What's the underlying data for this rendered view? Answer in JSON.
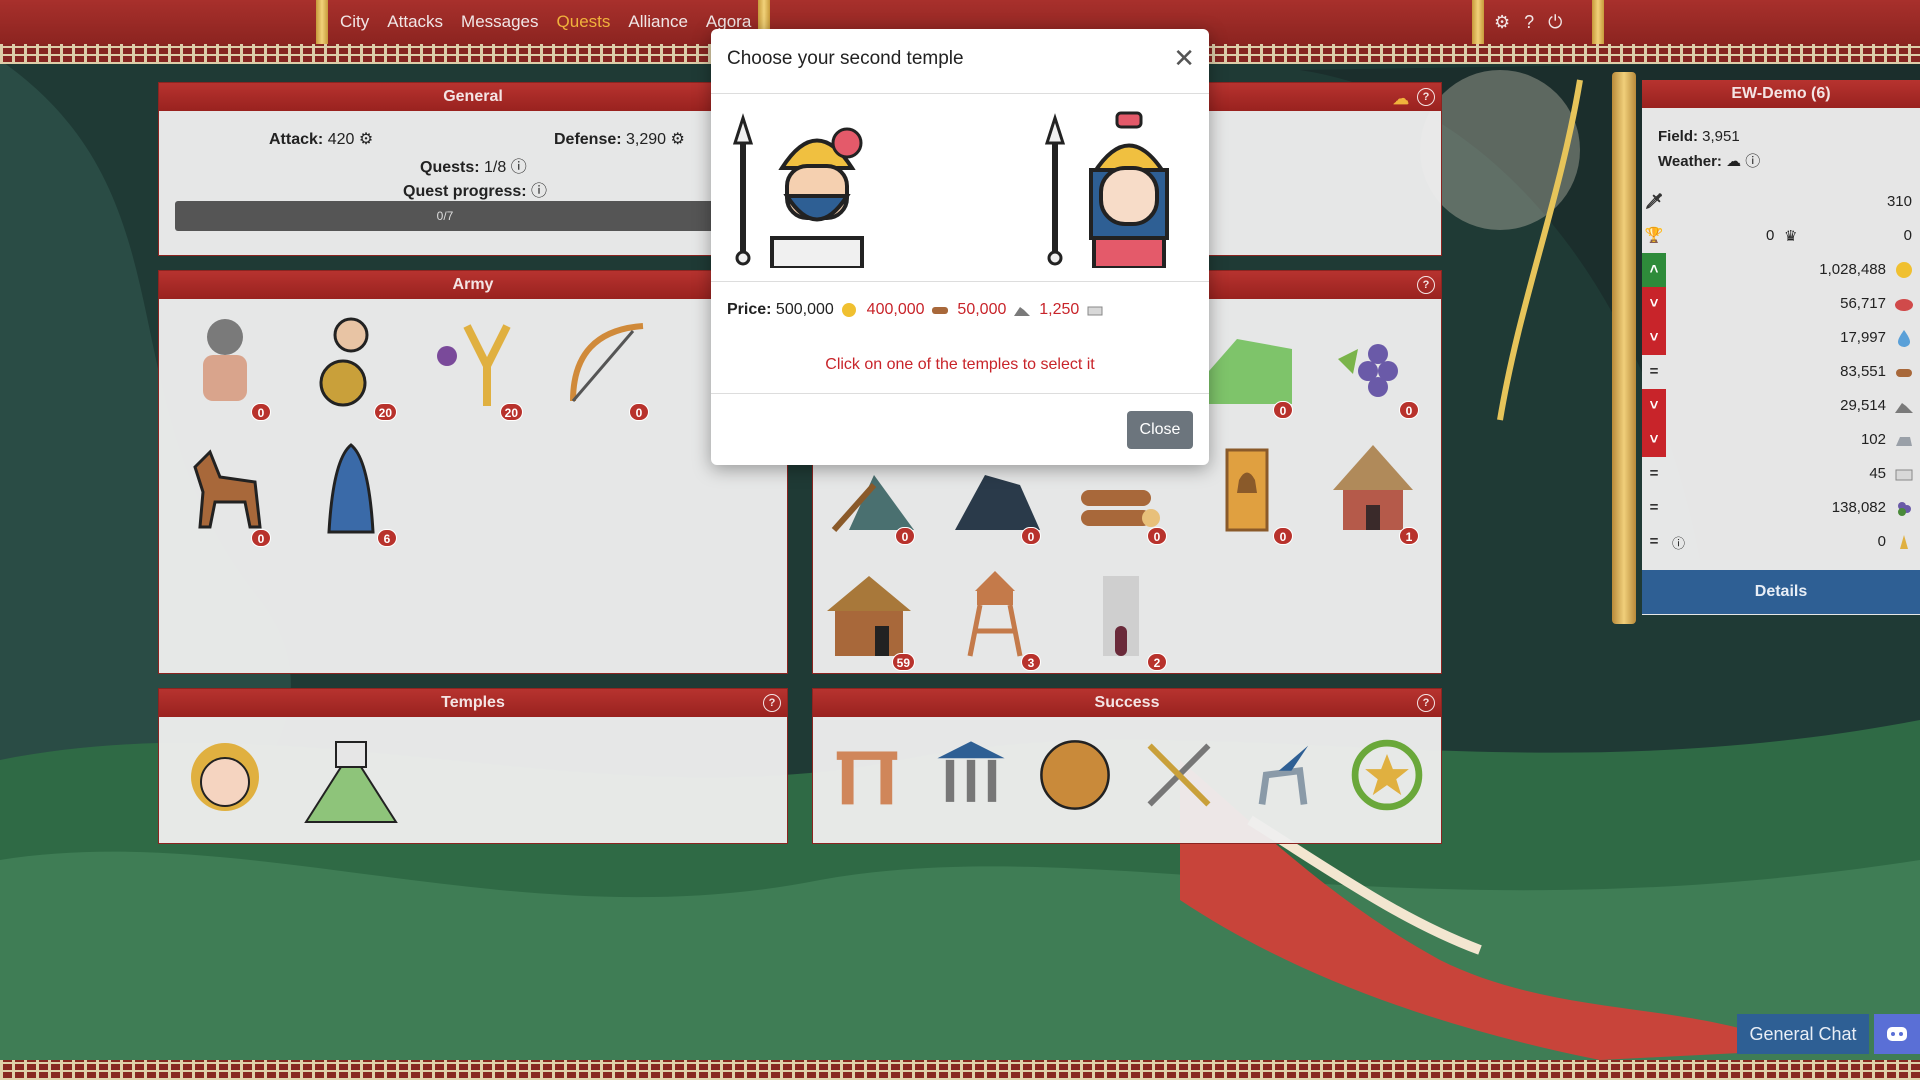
{
  "nav": {
    "links": [
      "City",
      "Attacks",
      "Messages",
      "Quests",
      "Alliance",
      "Agora"
    ],
    "active": "Quests"
  },
  "general": {
    "title": "General",
    "attack_label": "Attack:",
    "attack_value": "420",
    "defense_label": "Defense:",
    "defense_value": "3,290",
    "quests_label": "Quests:",
    "quests_value": "1/8",
    "quest_progress_label": "Quest progress:",
    "progress_text": "0/7"
  },
  "army": {
    "title": "Army",
    "units": [
      {
        "name": "hoplite",
        "count": "0"
      },
      {
        "name": "shield-bearer",
        "count": "20"
      },
      {
        "name": "slinger",
        "count": "20"
      },
      {
        "name": "archer",
        "count": "0"
      },
      {
        "name": "horseman",
        "count": "0"
      },
      {
        "name": "cloaked-spy",
        "count": "6"
      }
    ]
  },
  "buildings": {
    "counts": [
      "0",
      "0",
      "0",
      "0",
      "0",
      "0",
      "1",
      "0",
      "59",
      "3",
      "2"
    ]
  },
  "temples": {
    "title": "Temples"
  },
  "success": {
    "title": "Success"
  },
  "sidebar": {
    "title": "EW-Demo (6)",
    "field_label": "Field:",
    "field_value": "3,951",
    "weather_label": "Weather:",
    "rows": [
      {
        "mark": "",
        "value": "310",
        "icon": "sword-icon"
      },
      {
        "mark": "",
        "value": "0",
        "value2": "0",
        "icon": "trophy-icon"
      },
      {
        "mark": "^",
        "value": "1,028,488",
        "icon": "gold-coin-icon",
        "color": "#2e8b3a"
      },
      {
        "mark": "v",
        "value": "56,717",
        "icon": "meat-icon",
        "color": "#c8242a"
      },
      {
        "mark": "v",
        "value": "17,997",
        "icon": "water-icon",
        "color": "#c8242a"
      },
      {
        "mark": "=",
        "value": "83,551",
        "icon": "wood-icon",
        "color": ""
      },
      {
        "mark": "v",
        "value": "29,514",
        "icon": "stone-icon",
        "color": "#c8242a"
      },
      {
        "mark": "v",
        "value": "102",
        "icon": "iron-icon",
        "color": "#c8242a"
      },
      {
        "mark": "=",
        "value": "45",
        "icon": "marble-icon",
        "color": ""
      },
      {
        "mark": "=",
        "value": "138,082",
        "icon": "grapes-icon",
        "color": ""
      },
      {
        "mark": "=",
        "value": "0",
        "icon": "prayer-icon",
        "color": ""
      }
    ],
    "details_label": "Details"
  },
  "modal": {
    "title": "Choose your second temple",
    "price_label": "Price:",
    "price_gold": "500,000",
    "price_wood": "400,000",
    "price_stone": "50,000",
    "price_iron": "1,250",
    "hint": "Click on one of the temples to select it",
    "close_label": "Close"
  },
  "chat": {
    "label": "General Chat"
  },
  "colors": {
    "brand_red": "#99221f",
    "accent_gold": "#f0b23c",
    "blue": "#2e5f94"
  }
}
